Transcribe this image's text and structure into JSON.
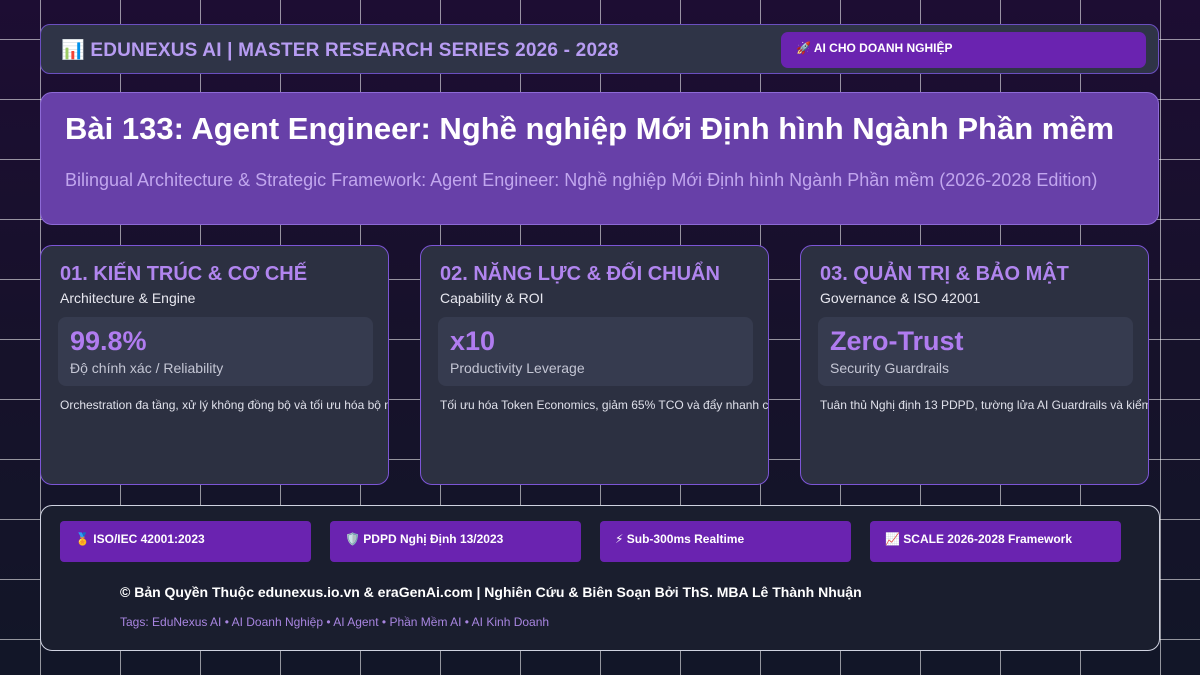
{
  "header": {
    "title": "📊 EDUNEXUS AI | MASTER RESEARCH SERIES 2026 - 2028",
    "badge": "🚀 AI CHO DOANH NGHIỆP"
  },
  "hero": {
    "title": "Bài 133: Agent Engineer: Nghề nghiệp Mới Định hình Ngành Phần mềm",
    "subtitle": "Bilingual Architecture & Strategic Framework: Agent Engineer: Nghề nghiệp Mới Định hình Ngành Phần mềm (2026-2028 Edition)"
  },
  "cards": [
    {
      "title": "01. KIẾN TRÚC & CƠ CHẾ",
      "subtitle": "Architecture & Engine",
      "metric_value": "99.8%",
      "metric_label": "Độ chính xác / Reliability",
      "description": "Orchestration đa tầng, xử lý không đồng bộ và tối ưu hóa bộ nhớ"
    },
    {
      "title": "02. NĂNG LỰC & ĐỐI CHUẨN",
      "subtitle": "Capability & ROI",
      "metric_value": "x10",
      "metric_label": "Productivity Leverage",
      "description": "Tối ưu hóa Token Economics, giảm 65% TCO và đẩy nhanh chu"
    },
    {
      "title": "03. QUẢN TRỊ & BẢO MẬT",
      "subtitle": "Governance & ISO 42001",
      "metric_value": "Zero-Trust",
      "metric_label": "Security Guardrails",
      "description": "Tuân thủ Nghị định 13 PDPD, tường lửa AI Guardrails và kiểm toán"
    }
  ],
  "footer": {
    "pills": [
      "🏅 ISO/IEC 42001:2023",
      "🛡️ PDPD Nghị Định 13/2023",
      "⚡ Sub-300ms Realtime",
      "📈 SCALE 2026-2028 Framework"
    ],
    "copyright": "© Bản Quyền Thuộc edunexus.io.vn & eraGenAi.com | Nghiên Cứu & Biên Soạn Bởi ThS. MBA Lê Thành Nhuận",
    "tags": "Tags: EduNexus AI • AI Doanh Nghiệp • AI Agent • Phần Mềm AI • AI Kinh Doanh"
  }
}
